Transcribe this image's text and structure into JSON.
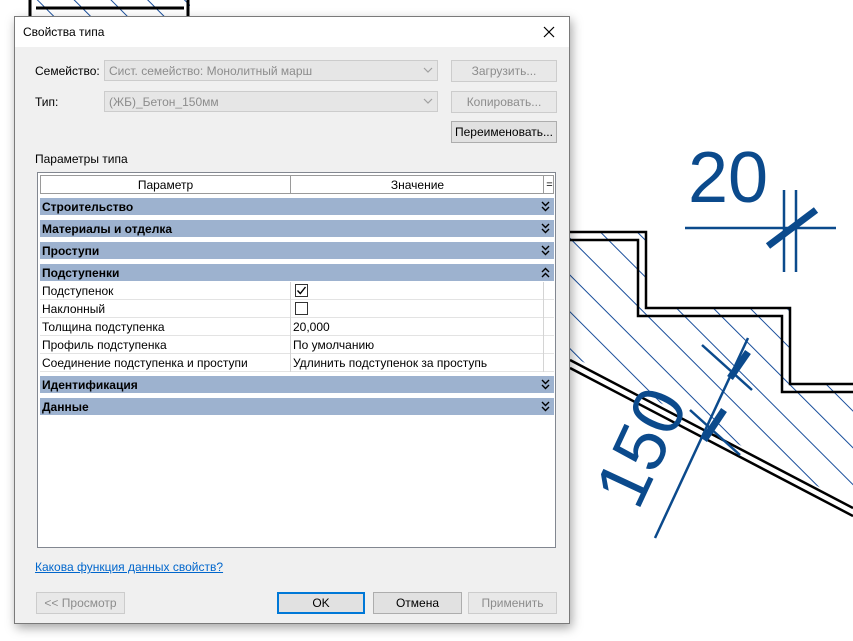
{
  "background_drawing": {
    "dimension_top": "20",
    "dimension_diagonal": "150",
    "line_color": "#0b4a8c"
  },
  "dialog": {
    "title": "Свойства типа",
    "family_label": "Семейство:",
    "family_value": "Сист. семейство: Монолитный марш",
    "type_label": "Тип:",
    "type_value": "(ЖБ)_Бетон_150мм",
    "load_button": "Загрузить...",
    "copy_button": "Копировать...",
    "rename_button": "Переименовать...",
    "params_label": "Параметры типа",
    "grid": {
      "col_param": "Параметр",
      "col_value": "Значение",
      "col_extra": "=",
      "group_color": "#9db2cf",
      "groups": [
        {
          "name": "Строительство",
          "state": "collapsed"
        },
        {
          "name": "Материалы и отделка",
          "state": "collapsed"
        },
        {
          "name": "Проступи",
          "state": "collapsed"
        },
        {
          "name": "Подступенки",
          "state": "expanded"
        },
        {
          "name": "Идентификация",
          "state": "collapsed"
        },
        {
          "name": "Данные",
          "state": "collapsed"
        }
      ],
      "rows": [
        {
          "name": "Подступенок",
          "type": "checkbox",
          "checked": true
        },
        {
          "name": "Наклонный",
          "type": "checkbox",
          "checked": false
        },
        {
          "name": "Толщина подступенка",
          "value": "20,000"
        },
        {
          "name": "Профиль подступенка",
          "value": "По умолчанию"
        },
        {
          "name": "Соединение подступенка и проступи",
          "value": "Удлинить подступенок за проступь"
        }
      ]
    },
    "help_link": "Какова функция данных свойств?",
    "preview_button": "<< Просмотр",
    "ok_button": "OK",
    "cancel_button": "Отмена",
    "apply_button": "Применить",
    "accent_color": "#0078d7"
  }
}
